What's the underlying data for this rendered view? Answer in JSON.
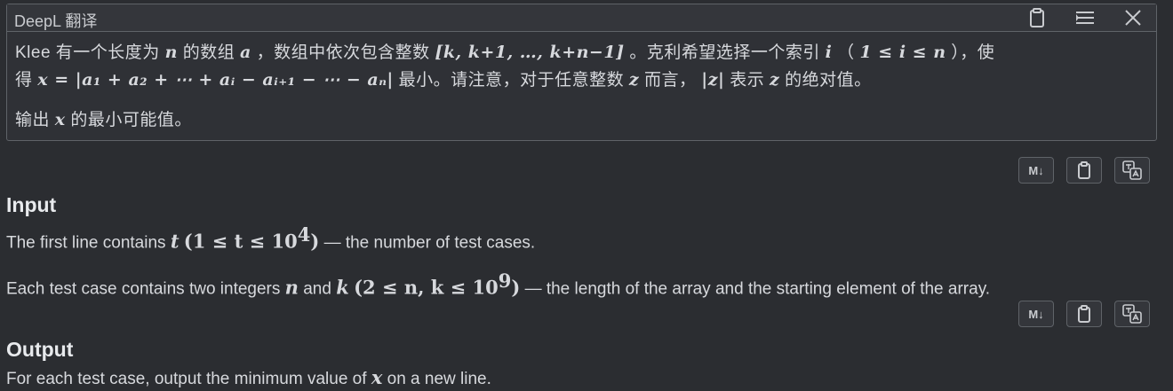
{
  "translator": {
    "title": "DeepL 翻译",
    "line1_a": "Klee 有一个长度为",
    "var_n": "n",
    "line1_b": "的数组",
    "var_a": "a",
    "line1_c": "，数组中依次包含整数",
    "seq": "[k, k+1, …, k+n−1]",
    "line1_d": "。克利希望选择一个索引",
    "var_i": "i",
    "paren_open": "（",
    "range_i": "1 ≤ i ≤ n",
    "line1_e": "），使",
    "line2_a": "得",
    "formula": "x = |a₁ + a₂ + ⋯ + aᵢ − aᵢ₊₁ − ⋯ − aₙ|",
    "line2_b": "最小。请注意，对于任意整数",
    "var_z": "z",
    "line2_c": "而言，",
    "abs_z": "|z|",
    "line2_d": "表示",
    "line2_e": "的绝对值。",
    "line3_a": "输出",
    "var_x": "x",
    "line3_b": "的最小可能值。"
  },
  "buttons": {
    "markdown": "M↓"
  },
  "input": {
    "title": "Input",
    "l1_a": "The first line contains",
    "t": "t",
    "l1_range": "(1 ≤ t ≤ 10",
    "l1_exp": "4",
    "l1_close": ")",
    "l1_b": "— the number of test cases.",
    "l2_a": "Each test case contains two integers",
    "n": "n",
    "and": "and",
    "k": "k",
    "l2_range": "(2 ≤ n, k ≤ 10",
    "l2_exp": "9",
    "l2_close": ")",
    "l2_b": "— the length of the array and the starting element of the array."
  },
  "output": {
    "title": "Output",
    "l1_a": "For each test case, output the minimum value of",
    "x": "x",
    "l1_b": "on a new line."
  }
}
